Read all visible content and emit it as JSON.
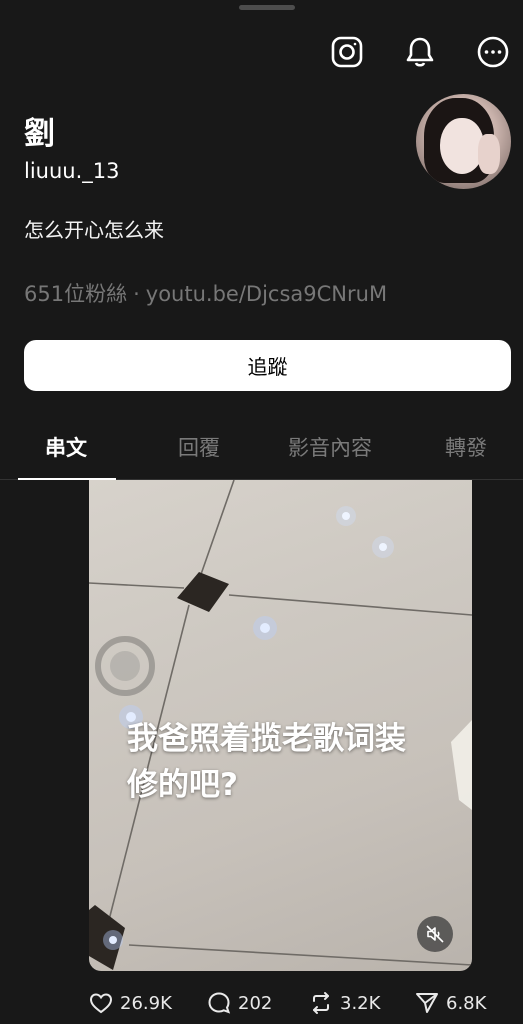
{
  "header": {
    "icons": [
      "instagram-icon",
      "bell-icon",
      "more-icon"
    ]
  },
  "profile": {
    "display_name": "劉",
    "username": "liuuu._13",
    "bio": "怎么开心怎么来",
    "followers": "651位粉絲",
    "separator": "·",
    "link": "youtu.be/Djcsa9CNruM",
    "follow_label": "追蹤"
  },
  "tabs": [
    {
      "label": "串文",
      "active": true
    },
    {
      "label": "回覆",
      "active": false
    },
    {
      "label": "影音內容",
      "active": false
    },
    {
      "label": "轉發",
      "active": false
    }
  ],
  "post": {
    "caption_line1": "我爸照着揽老歌词装",
    "caption_line2": "修的吧?",
    "likes": "26.9K",
    "comments": "202",
    "reposts": "3.2K",
    "shares": "6.8K"
  },
  "colors": {
    "background": "#181818",
    "muted_text": "#777777",
    "button_bg": "#ffffff"
  }
}
